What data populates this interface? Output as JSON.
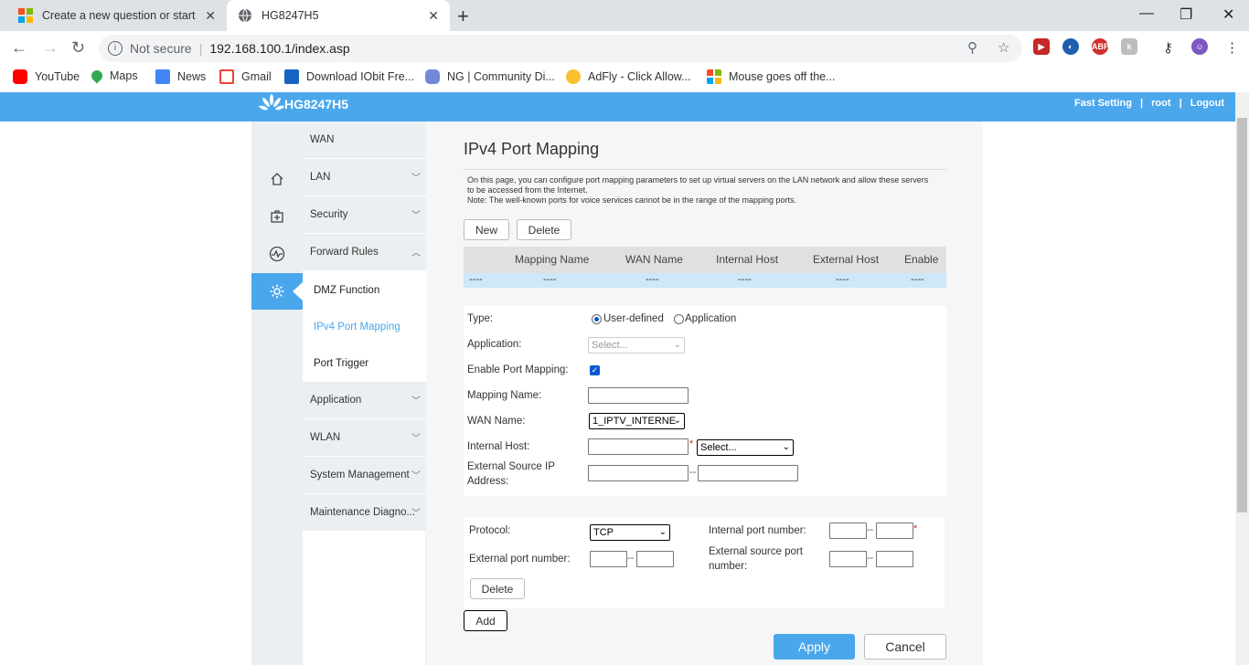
{
  "browser": {
    "tabs": [
      {
        "title": "Create a new question or start a d"
      },
      {
        "title": "HG8247H5"
      }
    ],
    "url": "192.168.100.1/index.asp",
    "security": "Not secure",
    "bookmarks": [
      {
        "label": "YouTube"
      },
      {
        "label": "Maps"
      },
      {
        "label": "News"
      },
      {
        "label": "Gmail"
      },
      {
        "label": "Download IObit Fre..."
      },
      {
        "label": "NG | Community Di..."
      },
      {
        "label": "AdFly - Click Allow..."
      },
      {
        "label": "Mouse goes off the..."
      }
    ]
  },
  "header": {
    "logo": "HG8247H5",
    "links": {
      "fast_setting": "Fast Setting",
      "user": "root",
      "logout": "Logout"
    }
  },
  "sidebar": {
    "items": [
      {
        "label": "WAN"
      },
      {
        "label": "LAN"
      },
      {
        "label": "Security"
      },
      {
        "label": "Forward Rules"
      },
      {
        "label": "DMZ Function"
      },
      {
        "label": "IPv4 Port Mapping"
      },
      {
        "label": "Port Trigger"
      },
      {
        "label": "Application"
      },
      {
        "label": "WLAN"
      },
      {
        "label": "System Management"
      },
      {
        "label": "Maintenance Diagno..."
      }
    ]
  },
  "main": {
    "title": "IPv4 Port Mapping",
    "description": "On this page, you can configure port mapping parameters to set up virtual servers on the LAN network and allow these servers to be accessed from the Internet.",
    "note": "Note: The well-known ports for voice services cannot be in the range of the mapping ports.",
    "buttons": {
      "new": "New",
      "delete": "Delete",
      "add": "Add",
      "apply": "Apply",
      "cancel": "Cancel",
      "delete_row": "Delete"
    },
    "table": {
      "headers": [
        "Mapping Name",
        "WAN Name",
        "Internal Host",
        "External Host",
        "Enable"
      ],
      "row": [
        "----",
        "----",
        "----",
        "----",
        "----",
        "----"
      ]
    },
    "form": {
      "type_label": "Type:",
      "type_options": [
        "User-defined",
        "Application"
      ],
      "application_label": "Application:",
      "application_value": "Select...",
      "enable_label": "Enable Port Mapping:",
      "mapping_name_label": "Mapping Name:",
      "wan_name_label": "WAN Name:",
      "wan_name_value": "1_IPTV_INTERNE",
      "internal_host_label": "Internal Host:",
      "internal_host_select": "Select...",
      "ext_src_ip_label_1": "External Source IP",
      "ext_src_ip_label_2": "Address:",
      "required": "*",
      "range_sep": "--"
    },
    "protocol": {
      "protocol_label": "Protocol:",
      "protocol_value": "TCP",
      "internal_port_label": "Internal port number:",
      "external_port_label": "External port number:",
      "ext_src_port_label_1": "External source port",
      "ext_src_port_label_2": "number:"
    }
  }
}
